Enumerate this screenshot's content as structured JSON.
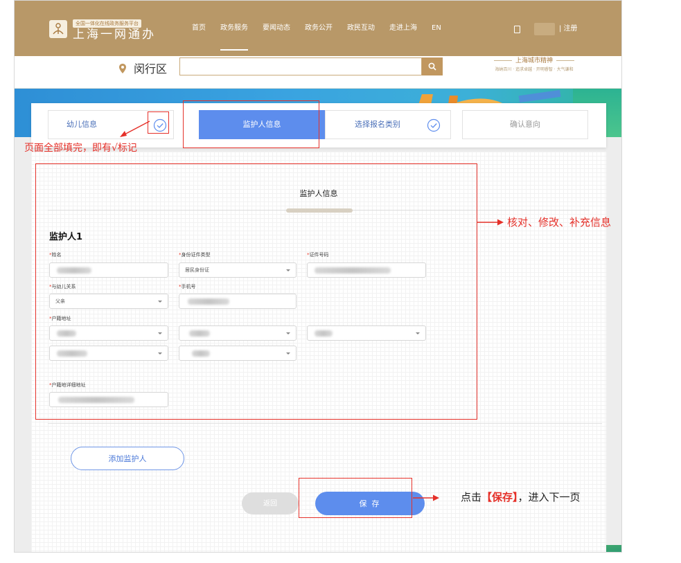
{
  "header": {
    "logo_tag": "全国一体化在线政务服务平台",
    "logo_name": "上海一网通办",
    "nav": [
      "首页",
      "政务服务",
      "要闻动态",
      "政务公开",
      "政民互动",
      "走进上海",
      "EN"
    ],
    "active_nav": 1,
    "register": "| 注册"
  },
  "search": {
    "district": "闵行区",
    "placeholder": "",
    "slogan_title": "上海城市精神",
    "slogan_sub": "海纳百川 · 追求卓越 · 开明睿智 · 大气谦和"
  },
  "steps": [
    {
      "label": "幼儿信息",
      "state": "done"
    },
    {
      "label": "监护人信息",
      "state": "active"
    },
    {
      "label": "选择报名类别",
      "state": "done"
    },
    {
      "label": "确认意向",
      "state": "pending"
    }
  ],
  "form": {
    "section_title": "监护人信息",
    "guardian_title": "监护人1",
    "required_mark": "*",
    "labels": {
      "name": "姓名",
      "id_type": "身份证件类型",
      "id_number": "证件号码",
      "relation": "与幼儿关系",
      "phone": "手机号",
      "household": "户籍地址",
      "household_detail": "户籍地详细地址"
    },
    "values": {
      "id_type": "居民身份证",
      "relation": "父亲"
    },
    "buttons": {
      "add_guardian": "添加监护人",
      "back": "返回",
      "save": "保 存"
    }
  },
  "annotations": {
    "complete_note": "页面全部填完，即有√标记",
    "check_note": "核对、修改、补充信息",
    "save_note_pre": "点击",
    "save_note_bold": "【保存】",
    "save_note_post": "，进入下一页"
  },
  "colors": {
    "header_bg": "#b89868",
    "accent_blue": "#5d8ded",
    "annotation_red": "#e53029"
  }
}
